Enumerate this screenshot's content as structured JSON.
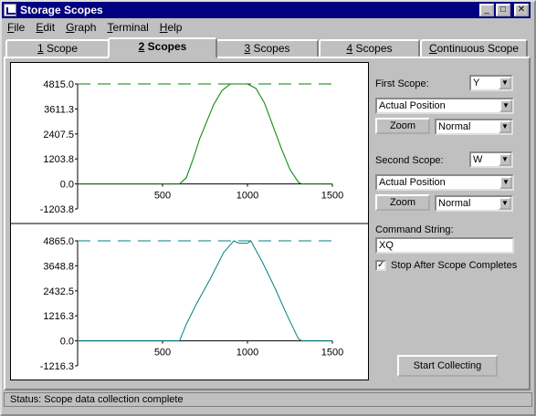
{
  "window": {
    "title": "Storage Scopes"
  },
  "menu": [
    {
      "key": "F",
      "rest": "ile"
    },
    {
      "key": "E",
      "rest": "dit"
    },
    {
      "key": "G",
      "rest": "raph"
    },
    {
      "key": "T",
      "rest": "erminal"
    },
    {
      "key": "H",
      "rest": "elp"
    }
  ],
  "tabs": [
    {
      "num": "1",
      "text": " Scope"
    },
    {
      "num": "2",
      "text": " Scopes"
    },
    {
      "num": "3",
      "text": " Scopes"
    },
    {
      "num": "4",
      "text": " Scopes"
    },
    {
      "num": "C",
      "text": "ontinuous Scope"
    }
  ],
  "active_tab": 1,
  "right_panel": {
    "first_scope_label": "First Scope:",
    "first_scope_axis": "Y",
    "first_scope_var": "Actual Position",
    "zoom1": "Zoom",
    "mode1": "Normal",
    "second_scope_label": "Second Scope:",
    "second_scope_axis": "W",
    "second_scope_var": "Actual Position",
    "zoom2": "Zoom",
    "mode2": "Normal",
    "command_label": "Command String:",
    "command_value": "XQ",
    "checkbox_label": "Stop After Scope Completes",
    "checkbox_checked": true,
    "start_button": "Start Collecting"
  },
  "status": {
    "text": "Status: Scope data collection complete"
  },
  "chart_data": [
    {
      "type": "line",
      "color": "#008000",
      "xlim": [
        0,
        1500
      ],
      "ylim": [
        -1203.8,
        4815.0
      ],
      "x_ticks": [
        500,
        1000,
        1500
      ],
      "y_ticks": [
        "4815.0",
        "3611.3",
        "2407.5",
        "1203.8",
        "0.0",
        "-1203.8"
      ],
      "y_tick_values": [
        4815.0,
        3611.3,
        2407.5,
        1203.8,
        0.0,
        -1203.8
      ],
      "max_line": 4815.0,
      "points": [
        [
          0,
          0
        ],
        [
          600,
          0
        ],
        [
          640,
          300
        ],
        [
          680,
          1200
        ],
        [
          720,
          2200
        ],
        [
          760,
          3000
        ],
        [
          800,
          3800
        ],
        [
          850,
          4500
        ],
        [
          900,
          4815
        ],
        [
          1000,
          4815
        ],
        [
          1050,
          4600
        ],
        [
          1100,
          3900
        ],
        [
          1150,
          2800
        ],
        [
          1200,
          1700
        ],
        [
          1250,
          700
        ],
        [
          1300,
          80
        ],
        [
          1320,
          0
        ],
        [
          1500,
          0
        ]
      ]
    },
    {
      "type": "line",
      "color": "#008080",
      "xlim": [
        0,
        1500
      ],
      "ylim": [
        -1216.3,
        4865.0
      ],
      "x_ticks": [
        500,
        1000,
        1500
      ],
      "y_ticks": [
        "4865.0",
        "3648.8",
        "2432.5",
        "1216.3",
        "0.0",
        "-1216.3"
      ],
      "y_tick_values": [
        4865.0,
        3648.8,
        2432.5,
        1216.3,
        0.0,
        -1216.3
      ],
      "max_line": 4865.0,
      "points": [
        [
          0,
          0
        ],
        [
          600,
          0
        ],
        [
          640,
          800
        ],
        [
          700,
          1800
        ],
        [
          780,
          3000
        ],
        [
          860,
          4300
        ],
        [
          920,
          4865
        ],
        [
          950,
          4750
        ],
        [
          1000,
          4750
        ],
        [
          1020,
          4865
        ],
        [
          1090,
          3800
        ],
        [
          1160,
          2600
        ],
        [
          1230,
          1300
        ],
        [
          1300,
          100
        ],
        [
          1320,
          0
        ],
        [
          1500,
          0
        ]
      ]
    }
  ]
}
